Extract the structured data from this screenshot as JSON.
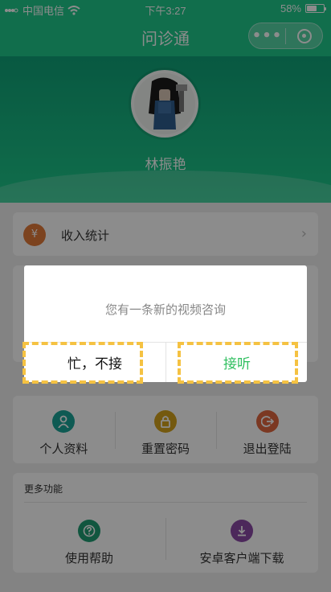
{
  "status_bar": {
    "carrier": "中国电信",
    "time": "下午3:27",
    "battery": "58%",
    "battery_level": 0.58
  },
  "nav": {
    "title": "问诊通",
    "more_icon": "•••",
    "home_icon": "target-icon"
  },
  "profile": {
    "name": "林振艳"
  },
  "menu": {
    "income_label": "收入统计",
    "income_icon": "¥"
  },
  "grid": [
    {
      "label": "个人资料",
      "icon": "person-icon",
      "color": "#1aa597"
    },
    {
      "label": "重置密码",
      "icon": "lock-icon",
      "color": "#d4a21d"
    },
    {
      "label": "退出登陆",
      "icon": "logout-icon",
      "color": "#e0663e"
    }
  ],
  "more": {
    "heading": "更多功能",
    "items": [
      {
        "label": "使用帮助",
        "icon": "help-icon",
        "color": "#1f9d73"
      },
      {
        "label": "安卓客户端下载",
        "icon": "download-icon",
        "color": "#8a4aa6"
      }
    ]
  },
  "dialog": {
    "message": "您有一条新的视频咨询",
    "cancel": "忙，不接",
    "confirm": "接听"
  }
}
